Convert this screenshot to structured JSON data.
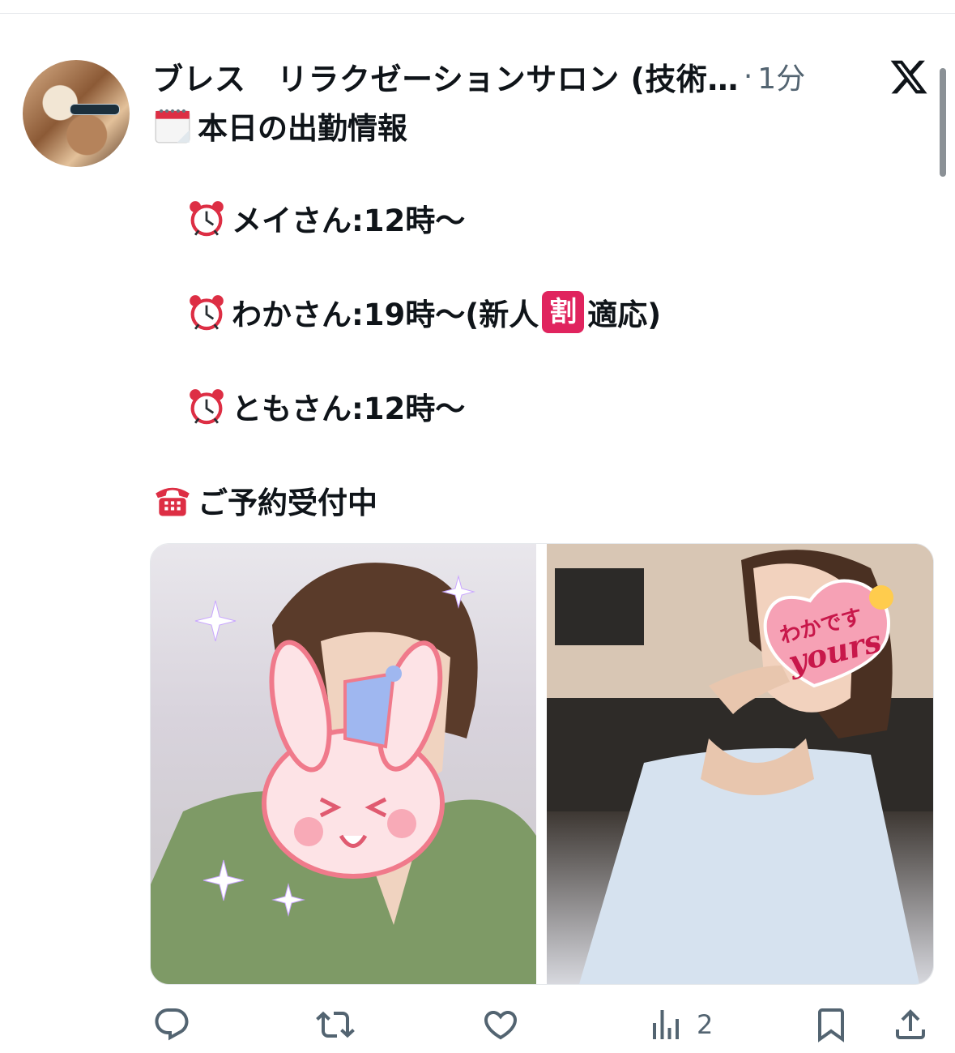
{
  "tweet": {
    "display_name": "ブレス　リラクゼーションサロン (技術…",
    "separator": "·",
    "time": "1分",
    "lines": [
      {
        "text": "本日の出勤情報",
        "emoji": "calendar-icon"
      },
      {
        "text": "メイさん:12時〜",
        "emoji": "alarm-clock-icon"
      },
      {
        "text_before": "わかさん:19時〜(新人",
        "badge": "割",
        "text_after": "適応)",
        "emoji": "alarm-clock-icon"
      },
      {
        "text": "ともさん:12時〜",
        "emoji": "alarm-clock-icon"
      },
      {
        "text": "ご予約受付中",
        "emoji": "telephone-icon"
      }
    ],
    "media": {
      "right_sticker_text": "わかです",
      "right_sticker_logo": "yours"
    }
  },
  "actions": {
    "reply_count": "",
    "repost_count": "",
    "like_count": "",
    "views_count": "2"
  },
  "colors": {
    "text": "#0f1419",
    "secondary": "#536471",
    "icon": "#536471",
    "badge_red": "#e0245e",
    "clock_red": "#dd2e44"
  }
}
